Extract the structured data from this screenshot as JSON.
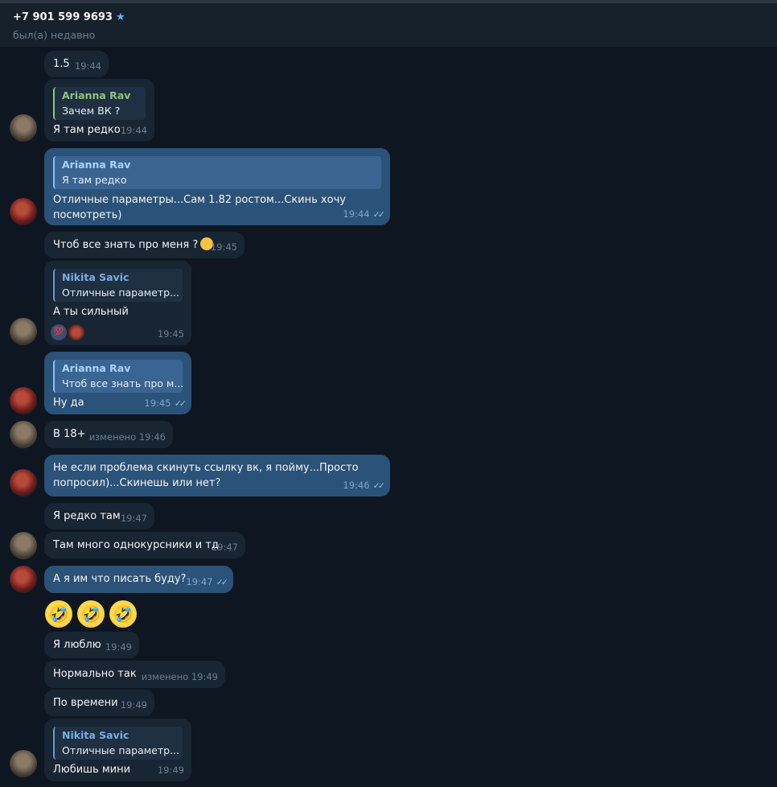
{
  "header": {
    "name": "+7 901 599 9693",
    "status": "был(а) недавно"
  },
  "messages": {
    "m1": {
      "text": "1.5",
      "time": "19:44"
    },
    "m2": {
      "reply_name": "Arianna Rav",
      "reply_text": "Зачем ВК ?",
      "text": "Я там редко",
      "time": "19:44"
    },
    "m3": {
      "reply_name": "Arianna Rav",
      "reply_text": "Я там редко",
      "line1": "Отличные параметры...Сам 1.82 ростом...Скинь хочу",
      "line2": "посмотреть)",
      "time": "19:44"
    },
    "m4": {
      "text": "Чтоб все знать про меня ?",
      "time": "19:45"
    },
    "m5": {
      "reply_name": "Nikita Savic",
      "reply_text": "Отличные параметр...",
      "text": "А ты сильный",
      "time": "19:45",
      "reaction": "💯"
    },
    "m6": {
      "reply_name": "Arianna Rav",
      "reply_text": "Чтоб все знать про м...",
      "text": "Ну да",
      "time": "19:45"
    },
    "m7": {
      "text": "В 18+",
      "time": "изменено 19:46"
    },
    "m8": {
      "line1": "Не если проблема скинуть ссылку вк, я пойму...Просто",
      "line2": "попросил)...Скинешь или нет?",
      "time": "19:46"
    },
    "m9": {
      "text": "Я редко там",
      "time": "19:47"
    },
    "m10": {
      "text": "Там много однокурсники и тд",
      "time": "19:47"
    },
    "m11": {
      "text": "А я им что писать буду?",
      "time": "19:47"
    },
    "m12": {
      "text": "Я люблю",
      "time": "19:49"
    },
    "m13": {
      "text": "Нормально так",
      "time": "изменено 19:49"
    },
    "m14": {
      "text": "По времени",
      "time": "19:49"
    },
    "m15": {
      "reply_name": "Nikita Savic",
      "reply_text": "Отличные параметр...",
      "text": "Любишь мини",
      "time": "19:49"
    }
  },
  "emoji_row": [
    "🤣",
    "🤣",
    "🤣"
  ],
  "icons": {
    "star": "star-icon",
    "double_check": "double-check-icon"
  },
  "colors": {
    "background": "#0e1621",
    "incoming": "#182533",
    "outgoing": "#2b5278",
    "accent": "#5eb5f7"
  }
}
